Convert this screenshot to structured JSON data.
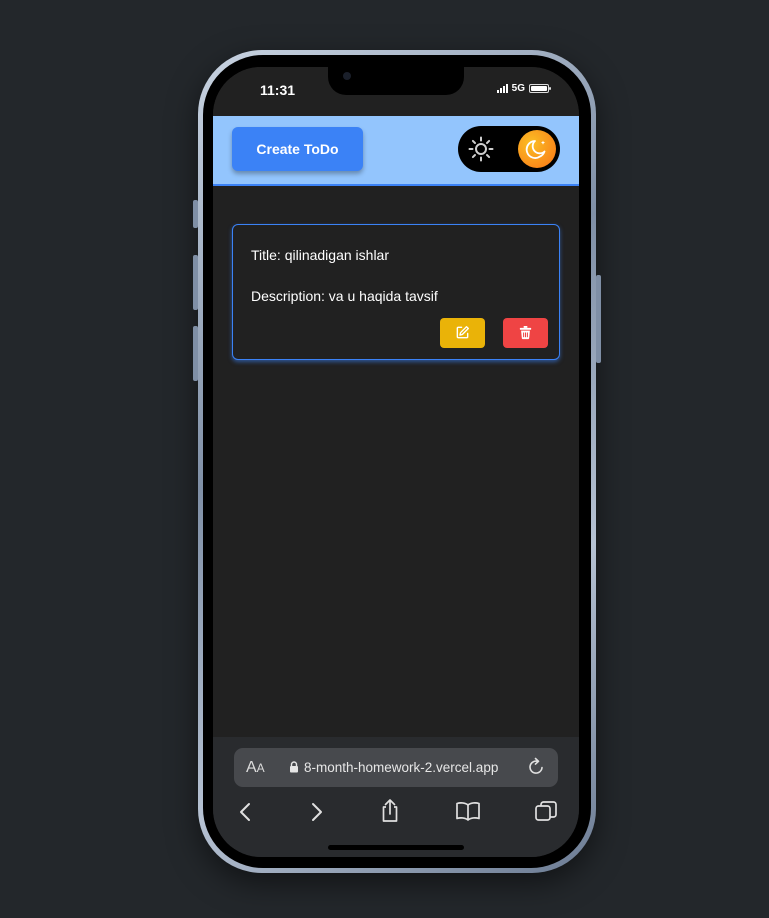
{
  "status_bar": {
    "time": "11:31",
    "network": "5G"
  },
  "header": {
    "create_button_label": "Create ToDo",
    "theme_toggle": {
      "mode": "dark"
    }
  },
  "todos": [
    {
      "title": "Title: qilinadigan ishlar",
      "description": "Description: va u haqida tavsif"
    }
  ],
  "browser": {
    "text_size_label": "A",
    "text_size_label_small": "A",
    "url": "8-month-homework-2.vercel.app"
  },
  "colors": {
    "header_bg": "#93c5fd",
    "primary": "#3b82f6",
    "edit": "#eab308",
    "delete": "#ef4444",
    "background": "#212121"
  },
  "icons": [
    "sun-icon",
    "moon-icon",
    "edit-icon",
    "trash-icon",
    "lock-icon",
    "reload-icon",
    "back-icon",
    "forward-icon",
    "share-icon",
    "bookmarks-icon",
    "tabs-icon"
  ]
}
